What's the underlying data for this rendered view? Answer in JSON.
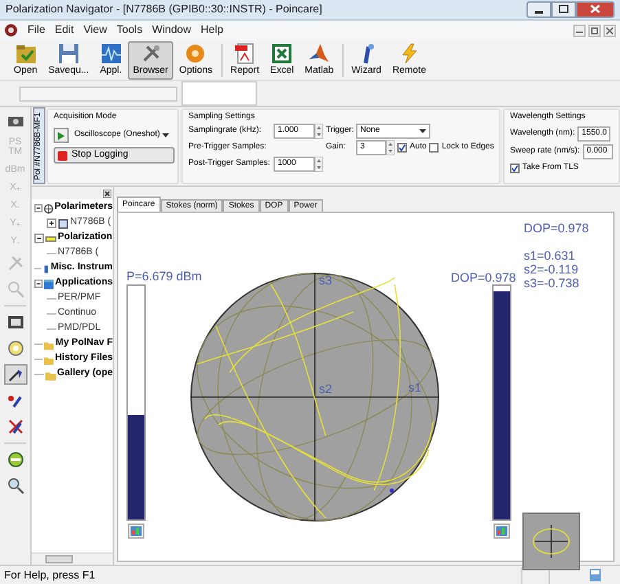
{
  "window": {
    "title": "Polarization Navigator - [N7786B (GPIB0::30::INSTR) - Poincare]"
  },
  "menu": [
    "File",
    "Edit",
    "View",
    "Tools",
    "Window",
    "Help"
  ],
  "toolbar": [
    {
      "kind": "open",
      "label": "Open",
      "selected": false
    },
    {
      "kind": "save",
      "label": "Savequ...",
      "selected": false
    },
    {
      "kind": "appl",
      "label": "Appl.",
      "selected": false
    },
    {
      "kind": "browser",
      "label": "Browser",
      "selected": true
    },
    {
      "kind": "options",
      "label": "Options",
      "selected": false
    },
    {
      "kind": "report",
      "label": "Report",
      "selected": false
    },
    {
      "kind": "excel",
      "label": "Excel",
      "selected": false
    },
    {
      "kind": "matlab",
      "label": "Matlab",
      "selected": false
    },
    {
      "kind": "wizard",
      "label": "Wizard",
      "selected": false
    },
    {
      "kind": "remote",
      "label": "Remote",
      "selected": false
    }
  ],
  "instrument_tab": "Pol #N7786B-MF1",
  "side_tools": [
    {
      "label": "PS TM",
      "disabled": true
    },
    {
      "label": "dBm",
      "disabled": true
    },
    {
      "label": "X$_{+}$",
      "disabled": true
    },
    {
      "label": "X$_{-}$",
      "disabled": true
    },
    {
      "label": "Y$_{+}$",
      "disabled": true
    },
    {
      "label": "Y$_{-}$",
      "disabled": true
    }
  ],
  "acquisition": {
    "title": "Acquisition Mode",
    "mode": "Oscilloscope (Oneshot)",
    "stop_button": "Stop Logging"
  },
  "sampling": {
    "title": "Sampling Settings",
    "samplingrate_label": "Samplingrate (kHz):",
    "samplingrate": "1.000",
    "pre_trigger_label": "Pre-Trigger Samples:",
    "post_trigger_label": "Post-Trigger Samples:",
    "post_trigger": "1000",
    "trigger_label": "Trigger:",
    "trigger": "None",
    "gain_label": "Gain:",
    "gain": "3",
    "auto": {
      "label": "Auto",
      "checked": true
    },
    "lock": {
      "label": "Lock to Edges",
      "checked": false
    }
  },
  "wavelength": {
    "title": "Wavelength Settings",
    "wavelength_label": "Wavelength (nm):",
    "wavelength": "1550.0",
    "sweep_label": "Sweep rate (nm/s):",
    "sweep": "0.000",
    "take_from_tls": {
      "label": "Take From TLS",
      "checked": true
    }
  },
  "tree": [
    {
      "label": "Polarimeters",
      "kind": "polarimeter",
      "expanded": true,
      "children": [
        {
          "label": "N7786B (",
          "kind": "device",
          "expanded": false
        }
      ]
    },
    {
      "label": "Polarization",
      "kind": "controller",
      "expanded": true,
      "children": [
        {
          "label": "N7786B (",
          "kind": "leaf"
        }
      ]
    },
    {
      "label": "Misc. Instrum",
      "kind": "misc"
    },
    {
      "label": "Applications",
      "kind": "apps",
      "expanded": true,
      "children": [
        {
          "label": "PER/PMF",
          "kind": "leaf"
        },
        {
          "label": "Continuo",
          "kind": "leaf"
        },
        {
          "label": "PMD/PDL",
          "kind": "leaf"
        }
      ]
    },
    {
      "label": "My PolNav F",
      "kind": "folder"
    },
    {
      "label": "History Files",
      "kind": "folder"
    },
    {
      "label": "Gallery (ope",
      "kind": "folder"
    }
  ],
  "tabs": [
    {
      "label": "Poincare",
      "selected": true
    },
    {
      "label": "Stokes (norm)",
      "selected": false
    },
    {
      "label": "Stokes",
      "selected": false
    },
    {
      "label": "DOP",
      "selected": false
    },
    {
      "label": "Power",
      "selected": false
    }
  ],
  "poincare": {
    "power_label": "P=6.679 dBm",
    "power": {
      "level": 0.45
    },
    "dop_label": "DOP=0.978",
    "dop": {
      "level": 0.978
    },
    "dop_readout": "DOP=0.978",
    "stokes": [
      "s1=0.631",
      "s2=-0.119",
      "s3=-0.738"
    ],
    "axes": {
      "s1": "s1",
      "s2": "s2",
      "s3": "s3"
    }
  },
  "status_bar": "For Help, press F1"
}
